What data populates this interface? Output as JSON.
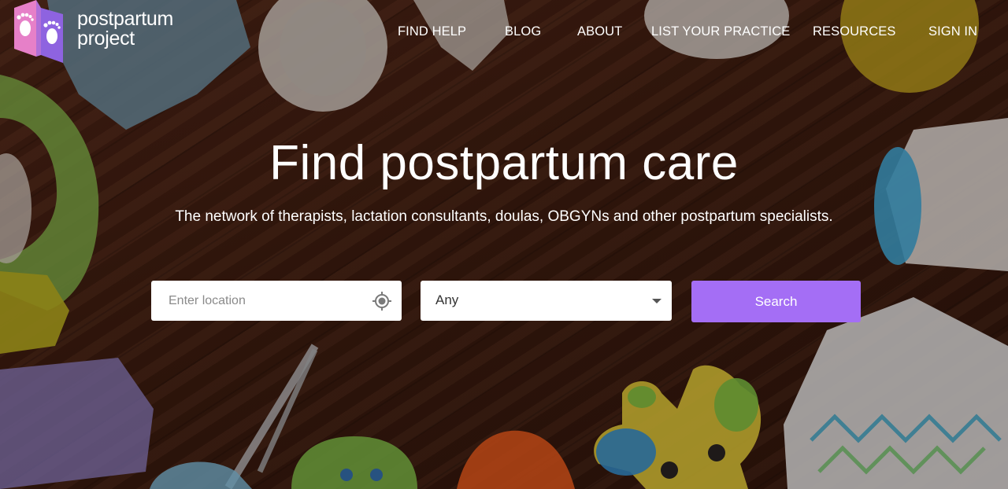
{
  "brand": {
    "name_line1": "postpartum",
    "name_line2": "project",
    "logo_icon": "baby-feet-logo-icon",
    "colors": {
      "pink": "#e680c8",
      "purple": "#8e63e0"
    }
  },
  "nav": {
    "items": [
      "FIND HELP",
      "BLOG",
      "ABOUT",
      "LIST YOUR PRACTICE",
      "RESOURCES",
      "SIGN IN"
    ]
  },
  "hero": {
    "title": "Find postpartum care",
    "subtitle": "The network of therapists, lactation consultants, doulas,  OBGYNs  and other postpartum specialists."
  },
  "search": {
    "location_placeholder": "Enter location",
    "location_icon": "gps-target-icon",
    "specialty_selected": "Any",
    "button_label": "Search",
    "button_color": "#a46ef5"
  }
}
